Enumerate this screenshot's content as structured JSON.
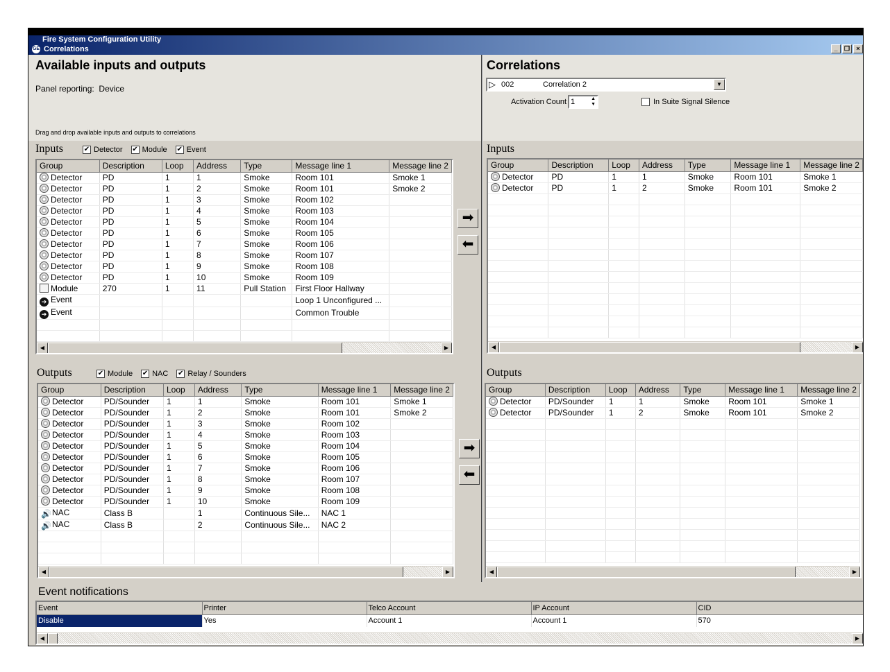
{
  "window": {
    "outer_title": "Fire System Configuration Utility",
    "title": "Correlations",
    "logo": "GE"
  },
  "left": {
    "heading": "Available inputs and outputs",
    "panel_reporting_label": "Panel reporting:",
    "panel_reporting_value": "Device",
    "drag_hint": "Drag and drop available inputs and outputs to correlations",
    "inputs": {
      "label": "Inputs",
      "filters": [
        {
          "label": "Detector",
          "checked": true
        },
        {
          "label": "Module",
          "checked": true
        },
        {
          "label": "Event",
          "checked": true
        }
      ],
      "columns": [
        "Group",
        "Description",
        "Loop",
        "Address",
        "Type",
        "Message line 1",
        "Message line 2"
      ],
      "rows": [
        {
          "icon": "detector",
          "group": "Detector",
          "description": "PD",
          "loop": "1",
          "address": "1",
          "type": "Smoke",
          "msg1": "Room 101",
          "msg2": "Smoke 1"
        },
        {
          "icon": "detector",
          "group": "Detector",
          "description": "PD",
          "loop": "1",
          "address": "2",
          "type": "Smoke",
          "msg1": "Room 101",
          "msg2": "Smoke 2"
        },
        {
          "icon": "detector",
          "group": "Detector",
          "description": "PD",
          "loop": "1",
          "address": "3",
          "type": "Smoke",
          "msg1": "Room 102",
          "msg2": ""
        },
        {
          "icon": "detector",
          "group": "Detector",
          "description": "PD",
          "loop": "1",
          "address": "4",
          "type": "Smoke",
          "msg1": "Room 103",
          "msg2": ""
        },
        {
          "icon": "detector",
          "group": "Detector",
          "description": "PD",
          "loop": "1",
          "address": "5",
          "type": "Smoke",
          "msg1": "Room 104",
          "msg2": ""
        },
        {
          "icon": "detector",
          "group": "Detector",
          "description": "PD",
          "loop": "1",
          "address": "6",
          "type": "Smoke",
          "msg1": "Room 105",
          "msg2": ""
        },
        {
          "icon": "detector",
          "group": "Detector",
          "description": "PD",
          "loop": "1",
          "address": "7",
          "type": "Smoke",
          "msg1": "Room 106",
          "msg2": ""
        },
        {
          "icon": "detector",
          "group": "Detector",
          "description": "PD",
          "loop": "1",
          "address": "8",
          "type": "Smoke",
          "msg1": "Room 107",
          "msg2": ""
        },
        {
          "icon": "detector",
          "group": "Detector",
          "description": "PD",
          "loop": "1",
          "address": "9",
          "type": "Smoke",
          "msg1": "Room 108",
          "msg2": ""
        },
        {
          "icon": "detector",
          "group": "Detector",
          "description": "PD",
          "loop": "1",
          "address": "10",
          "type": "Smoke",
          "msg1": "Room 109",
          "msg2": ""
        },
        {
          "icon": "module",
          "group": "Module",
          "description": "270",
          "loop": "1",
          "address": "11",
          "type": "Pull Station",
          "msg1": "First Floor Hallway",
          "msg2": ""
        },
        {
          "icon": "event",
          "group": "Event",
          "description": "",
          "loop": "",
          "address": "",
          "type": "",
          "msg1": "Loop 1 Unconfigured ...",
          "msg2": ""
        },
        {
          "icon": "event",
          "group": "Event",
          "description": "",
          "loop": "",
          "address": "",
          "type": "",
          "msg1": "Common Trouble",
          "msg2": ""
        }
      ]
    },
    "outputs": {
      "label": "Outputs",
      "filters": [
        {
          "label": "Module",
          "checked": true
        },
        {
          "label": "NAC",
          "checked": true
        },
        {
          "label": "Relay / Sounders",
          "checked": true
        }
      ],
      "columns": [
        "Group",
        "Description",
        "Loop",
        "Address",
        "Type",
        "Message line 1",
        "Message line 2"
      ],
      "rows": [
        {
          "icon": "detector",
          "group": "Detector",
          "description": "PD/Sounder",
          "loop": "1",
          "address": "1",
          "type": "Smoke",
          "msg1": "Room 101",
          "msg2": "Smoke 1"
        },
        {
          "icon": "detector",
          "group": "Detector",
          "description": "PD/Sounder",
          "loop": "1",
          "address": "2",
          "type": "Smoke",
          "msg1": "Room 101",
          "msg2": "Smoke 2"
        },
        {
          "icon": "detector",
          "group": "Detector",
          "description": "PD/Sounder",
          "loop": "1",
          "address": "3",
          "type": "Smoke",
          "msg1": "Room 102",
          "msg2": ""
        },
        {
          "icon": "detector",
          "group": "Detector",
          "description": "PD/Sounder",
          "loop": "1",
          "address": "4",
          "type": "Smoke",
          "msg1": "Room 103",
          "msg2": ""
        },
        {
          "icon": "detector",
          "group": "Detector",
          "description": "PD/Sounder",
          "loop": "1",
          "address": "5",
          "type": "Smoke",
          "msg1": "Room 104",
          "msg2": ""
        },
        {
          "icon": "detector",
          "group": "Detector",
          "description": "PD/Sounder",
          "loop": "1",
          "address": "6",
          "type": "Smoke",
          "msg1": "Room 105",
          "msg2": ""
        },
        {
          "icon": "detector",
          "group": "Detector",
          "description": "PD/Sounder",
          "loop": "1",
          "address": "7",
          "type": "Smoke",
          "msg1": "Room 106",
          "msg2": ""
        },
        {
          "icon": "detector",
          "group": "Detector",
          "description": "PD/Sounder",
          "loop": "1",
          "address": "8",
          "type": "Smoke",
          "msg1": "Room 107",
          "msg2": ""
        },
        {
          "icon": "detector",
          "group": "Detector",
          "description": "PD/Sounder",
          "loop": "1",
          "address": "9",
          "type": "Smoke",
          "msg1": "Room 108",
          "msg2": ""
        },
        {
          "icon": "detector",
          "group": "Detector",
          "description": "PD/Sounder",
          "loop": "1",
          "address": "10",
          "type": "Smoke",
          "msg1": "Room 109",
          "msg2": ""
        },
        {
          "icon": "nac",
          "group": "NAC",
          "description": "Class B",
          "loop": "",
          "address": "1",
          "type": "Continuous Sile...",
          "msg1": "NAC 1",
          "msg2": ""
        },
        {
          "icon": "nac",
          "group": "NAC",
          "description": "Class B",
          "loop": "",
          "address": "2",
          "type": "Continuous Sile...",
          "msg1": "NAC 2",
          "msg2": ""
        }
      ]
    }
  },
  "right": {
    "heading": "Correlations",
    "selector": {
      "number": "002",
      "name": "Correlation 2"
    },
    "activation_count_label": "Activation Count",
    "activation_count_value": "1",
    "suite_silence_label": "In Suite Signal Silence",
    "suite_silence_checked": false,
    "inputs": {
      "label": "Inputs",
      "columns": [
        "Group",
        "Description",
        "Loop",
        "Address",
        "Type",
        "Message line 1",
        "Message line 2"
      ],
      "rows": [
        {
          "icon": "detector",
          "group": "Detector",
          "description": "PD",
          "loop": "1",
          "address": "1",
          "type": "Smoke",
          "msg1": "Room 101",
          "msg2": "Smoke 1"
        },
        {
          "icon": "detector",
          "group": "Detector",
          "description": "PD",
          "loop": "1",
          "address": "2",
          "type": "Smoke",
          "msg1": "Room 101",
          "msg2": "Smoke 2"
        }
      ]
    },
    "outputs": {
      "label": "Outputs",
      "columns": [
        "Group",
        "Description",
        "Loop",
        "Address",
        "Type",
        "Message line 1",
        "Message line 2"
      ],
      "rows": [
        {
          "icon": "detector",
          "group": "Detector",
          "description": "PD/Sounder",
          "loop": "1",
          "address": "1",
          "type": "Smoke",
          "msg1": "Room 101",
          "msg2": "Smoke 1"
        },
        {
          "icon": "detector",
          "group": "Detector",
          "description": "PD/Sounder",
          "loop": "1",
          "address": "2",
          "type": "Smoke",
          "msg1": "Room 101",
          "msg2": "Smoke 2"
        }
      ]
    }
  },
  "event_notifications": {
    "label": "Event notifications",
    "columns": [
      "Event",
      "Printer",
      "Telco Account",
      "IP Account",
      "CID"
    ],
    "row": [
      "Disable",
      "Yes",
      "Account 1",
      "Account 1",
      "570"
    ]
  },
  "icons": {
    "add": "right-arrow-icon",
    "remove": "left-arrow-icon"
  },
  "colors": {
    "title_bar": "#0a246a",
    "selection": "#0a246a",
    "face": "#d4d0c8"
  }
}
